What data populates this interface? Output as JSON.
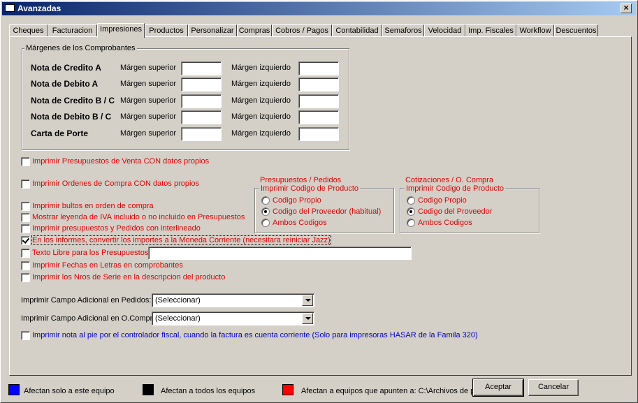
{
  "window": {
    "title": "Avanzadas",
    "close": "×"
  },
  "tabs": [
    "Cheques",
    "Facturacion",
    "Impresiones",
    "Productos",
    "Personalizar",
    "Compras",
    "Cobros / Pagos",
    "Contabilidad",
    "Semaforos",
    "Velocidad",
    "Imp. Fiscales",
    "Workflow",
    "Descuentos"
  ],
  "active_tab": "Impresiones",
  "margins": {
    "title": "Márgenes de los Comprobantes",
    "top_label": "Márgen superior",
    "left_label": "Márgen izquierdo",
    "rows": [
      {
        "name": "Nota de Credito A",
        "top": "",
        "left": ""
      },
      {
        "name": "Nota de Debito A",
        "top": "",
        "left": ""
      },
      {
        "name": "Nota de Credito B / C",
        "top": "",
        "left": ""
      },
      {
        "name": "Nota de Debito B / C",
        "top": "",
        "left": ""
      },
      {
        "name": "Carta de Porte",
        "top": "",
        "left": ""
      }
    ]
  },
  "checks": {
    "presupuestos_propios": {
      "label": "Imprimir Presupuestos de Venta CON datos propios",
      "checked": false
    },
    "ordenes_propios": {
      "label": "Imprimir Ordenes de Compra CON datos propios",
      "checked": false
    },
    "bultos": {
      "label": "Imprimir bultos en orden de compra",
      "checked": false
    },
    "leyenda_iva": {
      "label": "Mostrar leyenda de IVA incluido o no incluido en Presupuestos",
      "checked": false
    },
    "interlineado": {
      "label": "Imprimir presupuestos y Pedidos con interlineado",
      "checked": false
    },
    "moneda_corriente": {
      "label": "En los informes, convertir los importes a la Moneda Corriente (necesitara reiniciar Jazz)",
      "checked": true
    },
    "texto_libre": {
      "label": "Texto Libre para los Presupuestos:",
      "checked": false,
      "value": ""
    },
    "fechas_letras": {
      "label": "Imprimir Fechas en Letras en comprobantes",
      "checked": false
    },
    "nros_serie": {
      "label": "Imprimir los Nros de Serie en la descripcion del producto",
      "checked": false
    },
    "nota_pie": {
      "label": "Imprimir nota al pie por el controlador fiscal, cuando la factura es cuenta corriente (Solo para impresoras HASAR de la Famila 320)",
      "checked": false
    }
  },
  "pedidos_group": {
    "header": "Presupuestos / Pedidos",
    "title": "Imprimir Codigo de Producto",
    "options": [
      "Codigo Propio",
      "Codigo del Proveedor (habitual)",
      "Ambos Codigos"
    ],
    "selected": 1
  },
  "compra_group": {
    "header": "Cotizaciones / O. Compra",
    "title": "Imprimir Codigo de Producto",
    "options": [
      "Codigo Propio",
      "Codigo del Proveedor",
      "Ambos Codigos"
    ],
    "selected": 1
  },
  "combos": {
    "pedidos": {
      "label": "Imprimir Campo Adicional en Pedidos:",
      "value": "(Seleccionar)"
    },
    "ocompra": {
      "label": "Imprimir Campo Adicional en O.Compra:",
      "value": "(Seleccionar)"
    }
  },
  "legend": {
    "blue": {
      "text": "Afectan solo a este equipo",
      "color": "#0000ff"
    },
    "black": {
      "text": "Afectan a todos los equipos",
      "color": "#000000"
    },
    "red": {
      "text": "Afectan a equipos que apunten a: C:\\Archivos de pr...fi",
      "color": "#ff0000"
    }
  },
  "buttons": {
    "accept": "Aceptar",
    "cancel": "Cancelar"
  }
}
